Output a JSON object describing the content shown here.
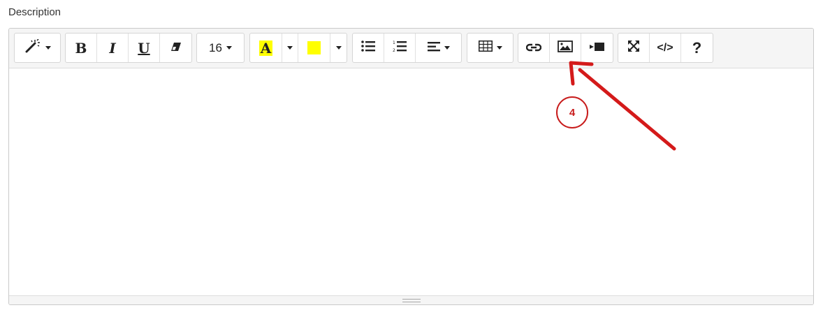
{
  "form": {
    "description_label": "Description"
  },
  "toolbar": {
    "font_size_value": "16",
    "forecolor_letter": "A",
    "forecolor_color": "#ffff00",
    "backcolor_color": "#ffff00"
  },
  "annotation": {
    "step_number": "4",
    "color": "#c81c1c"
  },
  "icons": {
    "style": "magic-wand-icon",
    "bold": "bold-icon",
    "italic": "italic-icon",
    "underline": "underline-icon",
    "clear_format": "eraser-icon",
    "unordered_list": "bulleted-list-icon",
    "ordered_list": "numbered-list-icon",
    "paragraph": "align-left-icon",
    "table": "table-icon",
    "link": "link-icon",
    "picture": "picture-icon",
    "video": "video-icon",
    "fullscreen": "fullscreen-icon",
    "codeview": "code-icon",
    "help": "help-icon"
  },
  "toolbar_text": {
    "bold": "B",
    "italic": "I",
    "underline": "U",
    "codeview": "</>",
    "help": "?"
  }
}
